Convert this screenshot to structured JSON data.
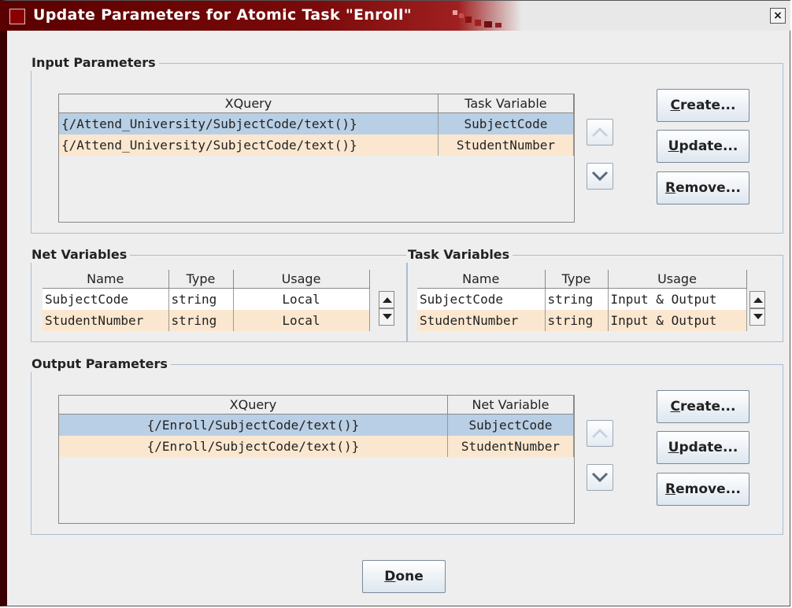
{
  "window": {
    "title": "Update Parameters for Atomic Task \"Enroll\"",
    "close_label": "×"
  },
  "input_parameters": {
    "label": "Input Parameters",
    "columns": [
      "XQuery",
      "Task Variable"
    ],
    "rows": [
      {
        "xquery": "{/Attend_University/SubjectCode/text()}",
        "variable": "SubjectCode"
      },
      {
        "xquery": "{/Attend_University/SubjectCode/text()}",
        "variable": "StudentNumber"
      }
    ],
    "buttons": {
      "create": "reate...",
      "create_mnemonic": "C",
      "update": "pdate...",
      "update_mnemonic": "U",
      "remove": "emove...",
      "remove_mnemonic": "R"
    }
  },
  "net_variables": {
    "label": "Net Variables",
    "columns": [
      "Name",
      "Type",
      "Usage"
    ],
    "rows": [
      {
        "name": "SubjectCode",
        "type": "string",
        "usage": "Local"
      },
      {
        "name": "StudentNumber",
        "type": "string",
        "usage": "Local"
      }
    ]
  },
  "task_variables": {
    "label": "Task Variables",
    "columns": [
      "Name",
      "Type",
      "Usage"
    ],
    "rows": [
      {
        "name": "SubjectCode",
        "type": "string",
        "usage": "Input & Output"
      },
      {
        "name": "StudentNumber",
        "type": "string",
        "usage": "Input & Output"
      }
    ]
  },
  "output_parameters": {
    "label": "Output Parameters",
    "columns": [
      "XQuery",
      "Net Variable"
    ],
    "rows": [
      {
        "xquery": "{/Enroll/SubjectCode/text()}",
        "variable": "SubjectCode"
      },
      {
        "xquery": "{/Enroll/SubjectCode/text()}",
        "variable": "StudentNumber"
      }
    ],
    "buttons": {
      "create": "reate...",
      "create_mnemonic": "C",
      "update": "pdate...",
      "update_mnemonic": "U",
      "remove": "emove...",
      "remove_mnemonic": "R"
    }
  },
  "done_button": {
    "mnemonic": "D",
    "label": "one"
  },
  "colors": {
    "title_bar": "#7a0a0a",
    "selected_row": "#b8cfe5",
    "alternate_row": "#fbe7cf",
    "panel": "#eeeeee",
    "group_border": "#a9bdd3"
  },
  "icons": [
    "move-up-icon",
    "move-down-icon",
    "scroll-up-icon",
    "scroll-down-icon",
    "close-icon"
  ]
}
